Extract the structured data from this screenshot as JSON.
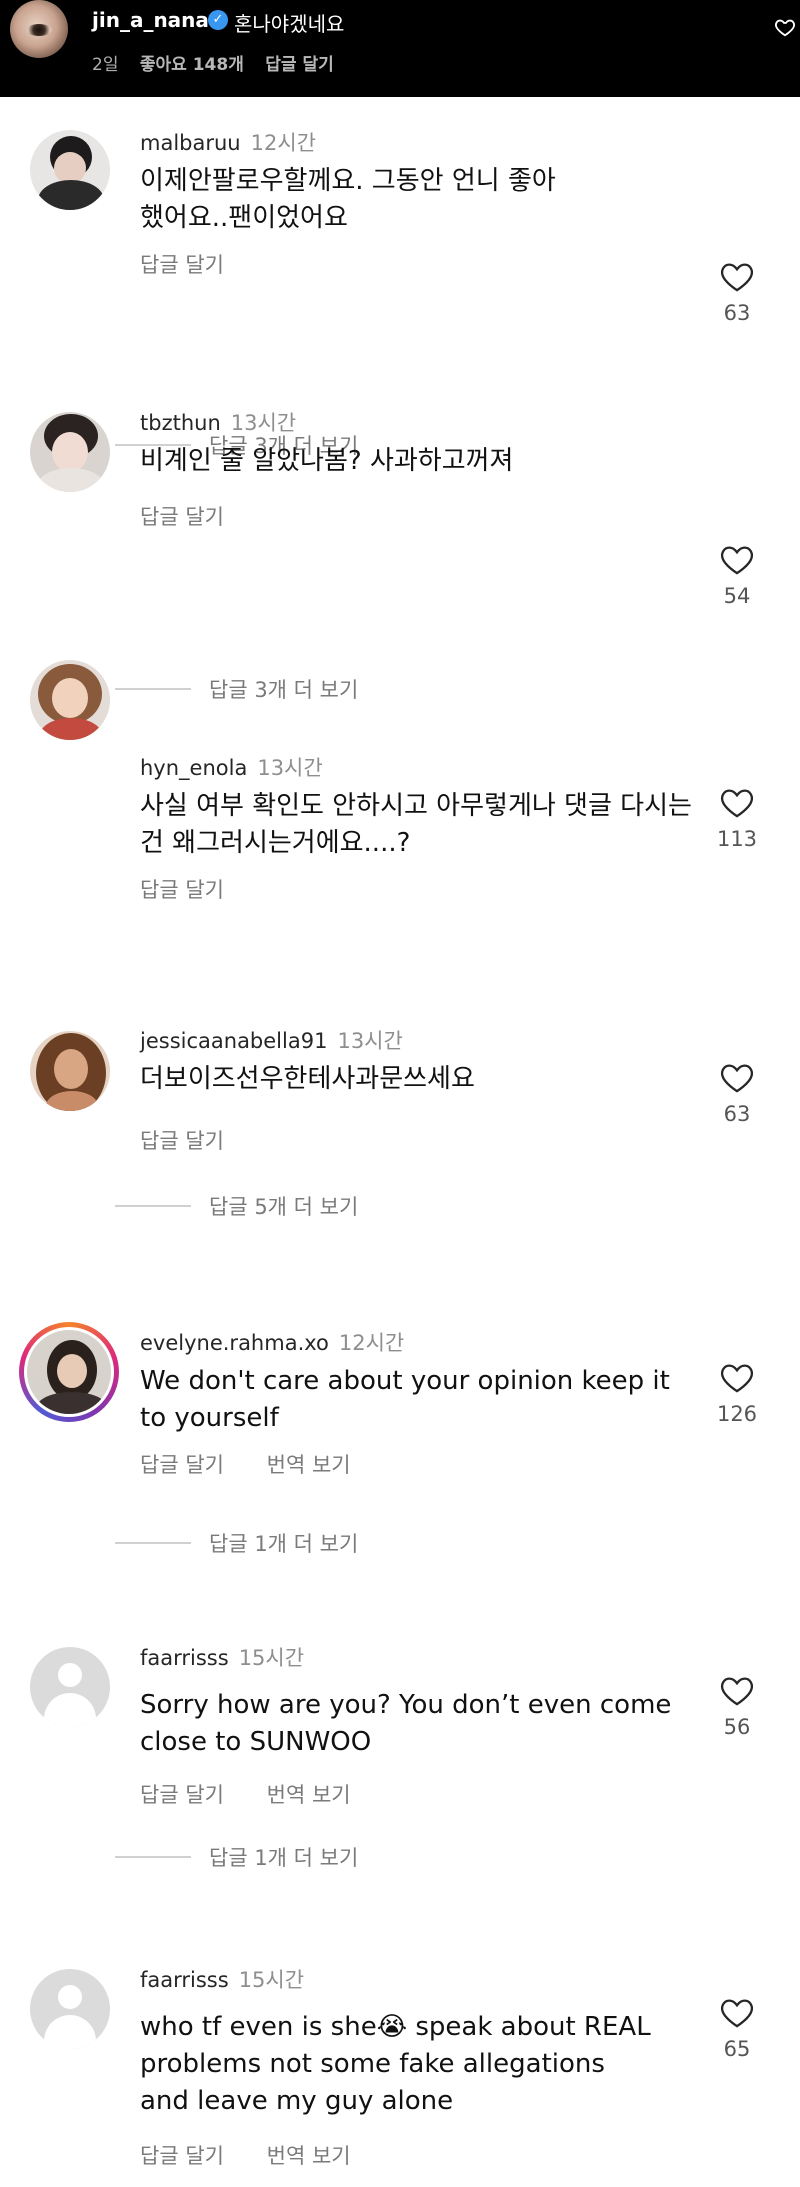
{
  "post": {
    "username": "jin_a_nana",
    "caption": "혼나야겠네요",
    "time": "2일",
    "likes": "좋아요 148개",
    "reply_label": "답글 달기",
    "icons": {
      "verified": "verified-badge-icon",
      "like": "heart-outline-icon"
    }
  },
  "comments": [
    {
      "username": "malbaruu",
      "time": "12시간",
      "text": "이제안팔로우할께요. 그동안 언니 좋아했어요..팬이었어요",
      "likes": "63",
      "reply": "답글 달기",
      "view_replies": "답글 3개 더 보기"
    },
    {
      "username": "tbzthun",
      "time": "13시간",
      "text": "비계인 줄 알았나봄? 사과하고꺼져",
      "likes": "54",
      "reply": "답글 달기",
      "view_replies": "답글 3개 더 보기"
    },
    {
      "username": "hyn_enola",
      "time": "13시간",
      "text": "사실 여부 확인도 안하시고 아무렇게나 댓글 다시는 건 왜그러시는거에요....?",
      "likes": "113",
      "reply": "답글 달기"
    },
    {
      "username": "jessicaanabella91",
      "time": "13시간",
      "text": "더보이즈선우한테사과문쓰세요",
      "likes": "63",
      "reply": "답글 달기",
      "view_replies": "답글 5개 더 보기"
    },
    {
      "username": "evelyne.rahma.xo",
      "time": "12시간",
      "text": "We don't care about your opinion keep it to yourself",
      "likes": "126",
      "reply": "답글 달기",
      "translate": "번역 보기",
      "view_replies": "답글 1개 더 보기"
    },
    {
      "username": "faarrisss",
      "time": "15시간",
      "text": "Sorry how are you? You don’t even come close to SUNWOO",
      "likes": "56",
      "reply": "답글 달기",
      "translate": "번역 보기",
      "view_replies": "답글 1개 더 보기"
    },
    {
      "username": "faarrisss",
      "time": "15시간",
      "text": "who tf even is she😭 speak about REAL problems not some fake allegations and leave my guy alone",
      "likes": "65",
      "reply": "답글 달기",
      "translate": "번역 보기"
    }
  ]
}
